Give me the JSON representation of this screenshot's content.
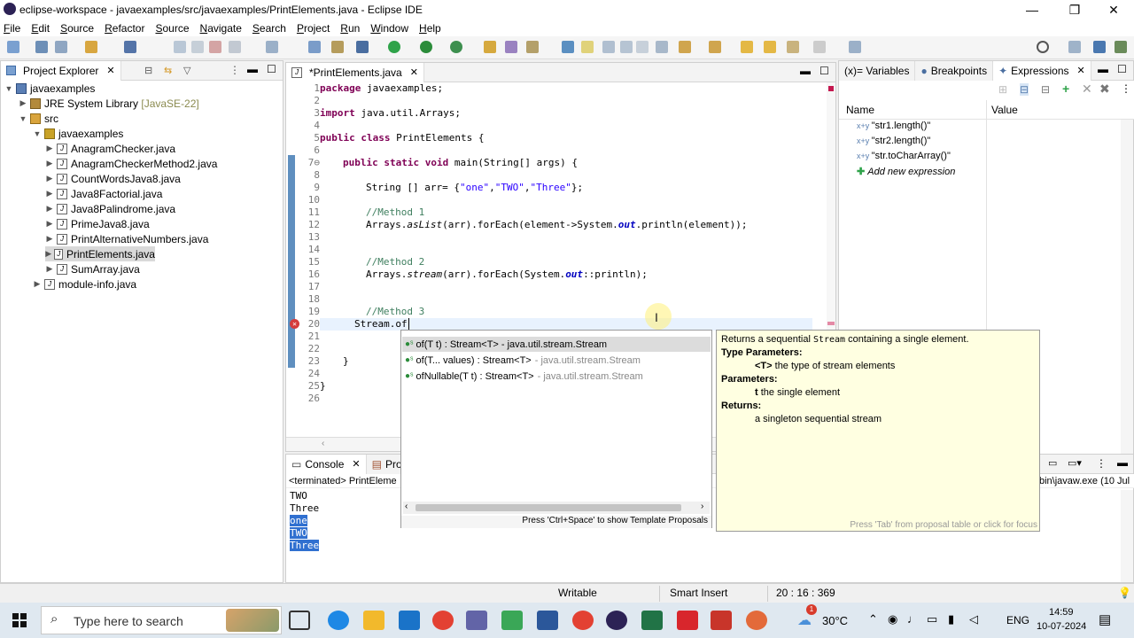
{
  "window": {
    "title": "eclipse-workspace - javaexamples/src/javaexamples/PrintElements.java - Eclipse IDE",
    "minimize": "—",
    "maximize": "❐",
    "close": "✕"
  },
  "menu": [
    "File",
    "Edit",
    "Source",
    "Refactor",
    "Source",
    "Navigate",
    "Search",
    "Project",
    "Run",
    "Window",
    "Help"
  ],
  "explorer": {
    "tab_label": "Project Explorer",
    "rows": [
      {
        "label": "javaexamples",
        "extra": ""
      },
      {
        "label": "JRE System Library",
        "extra": "[JavaSE-22]"
      },
      {
        "label": "src",
        "extra": ""
      },
      {
        "label": "javaexamples",
        "extra": ""
      },
      {
        "label": "AnagramChecker.java",
        "extra": ""
      },
      {
        "label": "AnagramCheckerMethod2.java",
        "extra": ""
      },
      {
        "label": "CountWordsJava8.java",
        "extra": ""
      },
      {
        "label": "Java8Factorial.java",
        "extra": ""
      },
      {
        "label": "Java8Palindrome.java",
        "extra": ""
      },
      {
        "label": "PrimeJava8.java",
        "extra": ""
      },
      {
        "label": "PrintAlternativeNumbers.java",
        "extra": ""
      },
      {
        "label": "PrintElements.java",
        "extra": ""
      },
      {
        "label": "SumArray.java",
        "extra": ""
      },
      {
        "label": "module-info.java",
        "extra": ""
      }
    ]
  },
  "editor": {
    "tab_label": "*PrintElements.java",
    "line_numbers": [
      "1",
      "2",
      "3",
      "4",
      "5",
      "6",
      "7⊖",
      "8",
      "9",
      "10",
      "11",
      "12",
      "13",
      "14",
      "15",
      "16",
      "17",
      "18",
      "19",
      "20",
      "21",
      "22",
      "23",
      "24",
      "25",
      "26"
    ]
  },
  "code": {
    "l1_kw": "package",
    "l1_rest": " javaexamples;",
    "l3_kw": "import",
    "l3_rest": " java.util.Arrays;",
    "l5_kw1": "public",
    "l5_kw2": "class",
    "l5_rest": " PrintElements {",
    "l7_kw1": "public",
    "l7_kw2": "static",
    "l7_kw3": "void",
    "l7_rest": " main(String[] args) {",
    "l9_a": "String [] arr= {",
    "l9_s1": "\"one\"",
    "l9_s2": "\"TWO\"",
    "l9_s3": "\"Three\"",
    "l9_b": "};",
    "l11": "//Method 1",
    "l12_a": "Arrays.",
    "l12_m": "asList",
    "l12_b": "(arr).forEach(element->System.",
    "l12_f": "out",
    "l12_c": ".println(element));",
    "l15": "//Method 2",
    "l16_a": "Arrays.",
    "l16_m": "stream",
    "l16_b": "(arr).forEach(System.",
    "l16_f": "out",
    "l16_c": "::println);",
    "l19": "//Method 3",
    "l20": "Stream.of",
    "l23": "}",
    "l25": "}"
  },
  "proposals": {
    "items": [
      {
        "main": "of(T t) : Stream<T> - java.util.stream.Stream",
        "gray": ""
      },
      {
        "main": "of(T... values) : Stream<T>",
        "gray": "- java.util.stream.Stream"
      },
      {
        "main": "ofNullable(T t) : Stream<T>",
        "gray": "- java.util.stream.Stream"
      }
    ],
    "footer": "Press 'Ctrl+Space' to show Template Proposals"
  },
  "javadoc": {
    "summary_a": "Returns a sequential ",
    "summary_code": "Stream",
    "summary_b": " containing a single element.",
    "type_params_head": "Type Parameters:",
    "type_param": "<T>",
    "type_param_desc": " the type of stream elements",
    "params_head": "Parameters:",
    "param": "t",
    "param_desc": " the single element",
    "returns_head": "Returns:",
    "returns_desc": "a singleton sequential stream",
    "footer": "Press 'Tab' from proposal table or click for focus"
  },
  "right_panel": {
    "tabs": [
      "(x)= Variables",
      "Breakpoints",
      "Expressions"
    ],
    "col_name": "Name",
    "col_value": "Value",
    "expressions": [
      "\"str1.length()\"",
      "\"str2.length()\"",
      "\"str.toCharArray()\""
    ],
    "add_label": "Add new expression"
  },
  "console": {
    "tab_label": "Console",
    "tab2_label": "Pro",
    "header": "<terminated> PrintEleme",
    "header_right": "bin\\javaw.exe (10 Jul",
    "lines": [
      "TWO",
      "Three",
      "one",
      "TWO",
      "Three"
    ]
  },
  "status": {
    "writable": "Writable",
    "insert": "Smart Insert",
    "position": "20 : 16 : 369"
  },
  "taskbar": {
    "search": "Type here to search",
    "temp": "30°C",
    "lang": "ENG",
    "time": "14:59",
    "date": "10-07-2024",
    "badge": "1"
  }
}
